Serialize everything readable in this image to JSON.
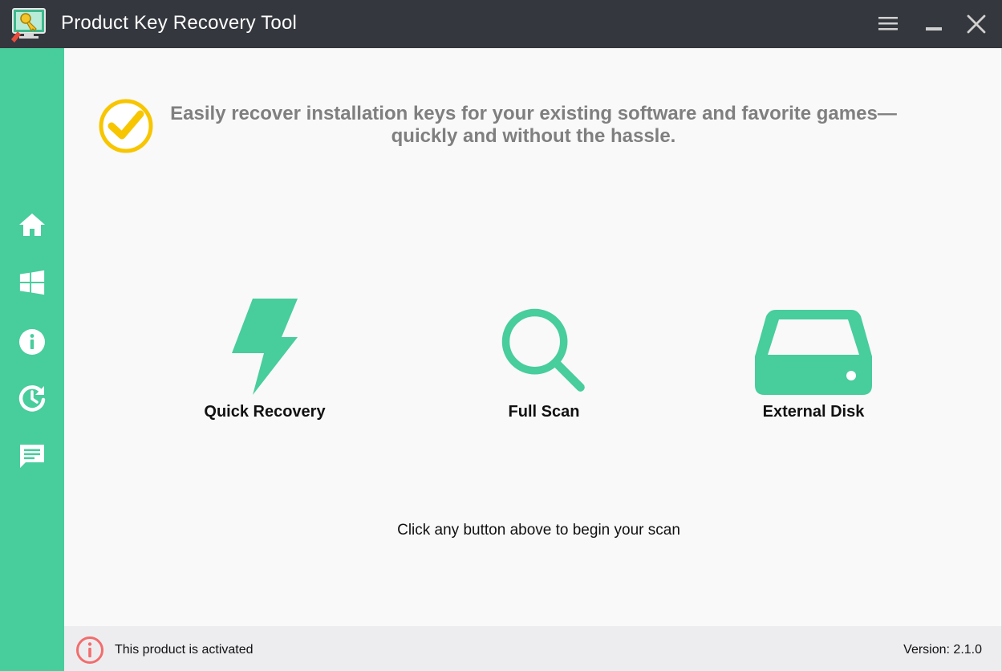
{
  "window": {
    "title": "Product Key Recovery Tool",
    "controls": {
      "menu_icon": "hamburger-menu-icon",
      "minimize_icon": "minimize-icon",
      "close_icon": "close-icon"
    }
  },
  "sidebar": {
    "accent": "#48cd9d",
    "items": [
      {
        "icon": "home-icon"
      },
      {
        "icon": "windows-icon"
      },
      {
        "icon": "info-icon"
      },
      {
        "icon": "history-icon"
      },
      {
        "icon": "feedback-icon"
      }
    ]
  },
  "header": {
    "tagline": "Easily recover installation keys for your existing software and favorite games—quickly and without the hassle.",
    "badge_color": "#f7c600"
  },
  "actions": [
    {
      "label": "Quick Recovery",
      "icon": "lightning-icon"
    },
    {
      "label": "Full Scan",
      "icon": "magnifier-icon"
    },
    {
      "label": "External Disk",
      "icon": "hard-disk-icon"
    }
  ],
  "hint": "Click any button above to begin your scan",
  "footer": {
    "status": "This product is activated",
    "version": "Version: 2.1.0",
    "status_icon_color": "#f26d6d"
  }
}
